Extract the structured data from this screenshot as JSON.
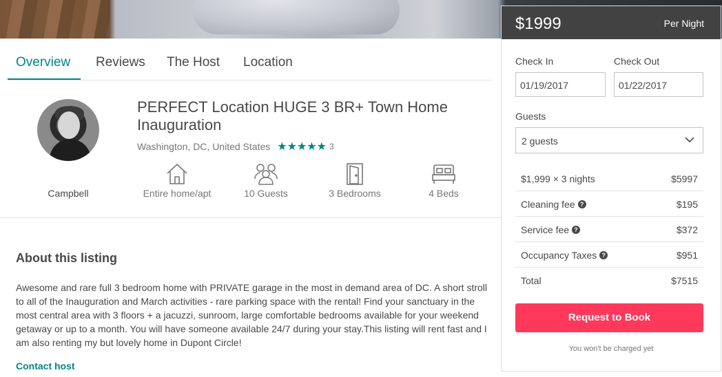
{
  "tabs": [
    {
      "label": "Overview"
    },
    {
      "label": "Reviews"
    },
    {
      "label": "The Host"
    },
    {
      "label": "Location"
    }
  ],
  "host": {
    "name": "Campbell"
  },
  "listing": {
    "title": "PERFECT Location HUGE 3 BR+ Town Home Inauguration",
    "location": "Washington, DC, United States",
    "rating_stars": 5,
    "review_count": "3",
    "amenities": [
      {
        "icon": "home-icon",
        "label": "Entire home/apt"
      },
      {
        "icon": "guests-icon",
        "label": "10 Guests"
      },
      {
        "icon": "door-icon",
        "label": "3 Bedrooms"
      },
      {
        "icon": "bed-icon",
        "label": "4 Beds"
      }
    ]
  },
  "about": {
    "heading": "About this listing",
    "text": "Awesome and rare full 3 bedroom home with PRIVATE garage in the most in demand area of DC. A short stroll to all of the Inauguration and March activities - rare parking space with the rental! Find your sanctuary in the most central area with 3 floors + a jacuzzi, sunroom, large comfortable bedrooms available for your weekend getaway or up to a month. You will have someone available 24/7 during your stay.This listing will rent fast and I am also renting my but lovely home in Dupont Circle!",
    "contact_label": "Contact host"
  },
  "booking": {
    "price": "$1999",
    "per_night": "Per Night",
    "check_in_label": "Check In",
    "check_in_value": "01/19/2017",
    "check_out_label": "Check Out",
    "check_out_value": "01/22/2017",
    "guests_label": "Guests",
    "guests_value": "2 guests",
    "line_items": [
      {
        "label": "$1,999 × 3 nights",
        "value": "$5997",
        "help": false
      },
      {
        "label": "Cleaning fee",
        "value": "$195",
        "help": true
      },
      {
        "label": "Service fee",
        "value": "$372",
        "help": true
      },
      {
        "label": "Occupancy Taxes",
        "value": "$951",
        "help": true
      },
      {
        "label": "Total",
        "value": "$7515",
        "help": false
      }
    ],
    "button_label": "Request to Book",
    "note": "You won't be charged yet"
  },
  "colors": {
    "accent": "#008489",
    "cta": "#ff385c",
    "text": "#484848"
  }
}
